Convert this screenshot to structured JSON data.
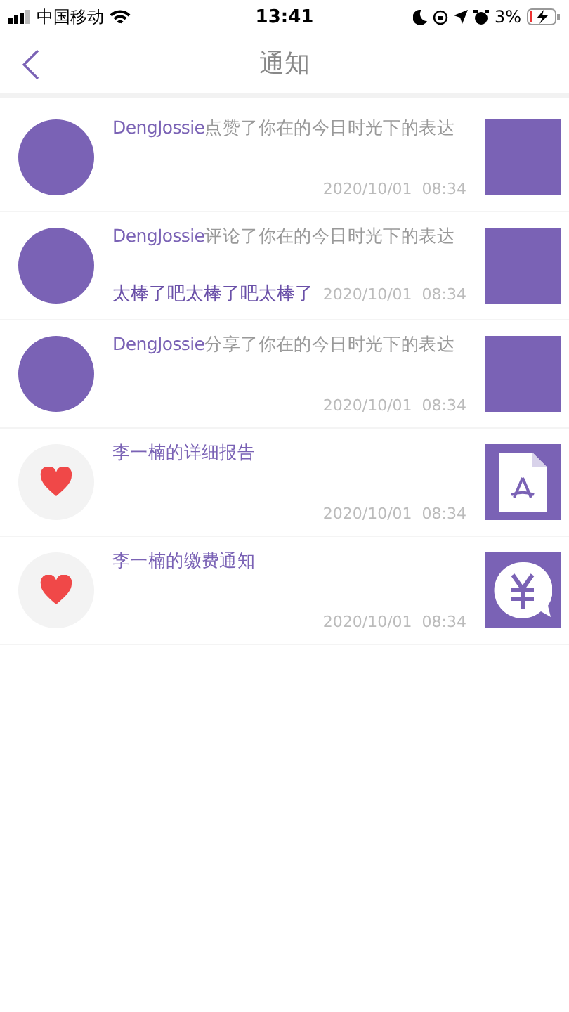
{
  "status_bar": {
    "carrier": "中国移动",
    "time": "13:41",
    "battery": "3%"
  },
  "nav": {
    "title": "通知"
  },
  "notifications": [
    {
      "avatar": {
        "kind": "user"
      },
      "name": "DengJossie",
      "action": "点赞了你在的今日时光下的表达",
      "time": "2020/10/01  08:34",
      "thumbnail": {
        "kind": "image"
      }
    },
    {
      "avatar": {
        "kind": "user"
      },
      "name": "DengJossie",
      "action": "评论了你在的今日时光下的表达",
      "comment": "太棒了吧太棒了吧太棒了",
      "time": "2020/10/01  08:34",
      "thumbnail": {
        "kind": "image"
      }
    },
    {
      "avatar": {
        "kind": "user"
      },
      "name": "DengJossie",
      "action": "分享了你在的今日时光下的表达",
      "time": "2020/10/01  08:34",
      "thumbnail": {
        "kind": "image"
      }
    },
    {
      "avatar": {
        "kind": "heart"
      },
      "name": "李一楠的详细报告",
      "time": "2020/10/01  08:34",
      "thumbnail": {
        "kind": "pdf"
      }
    },
    {
      "avatar": {
        "kind": "heart"
      },
      "name": "李一楠的缴费通知",
      "time": "2020/10/01  08:34",
      "thumbnail": {
        "kind": "payment"
      }
    }
  ]
}
